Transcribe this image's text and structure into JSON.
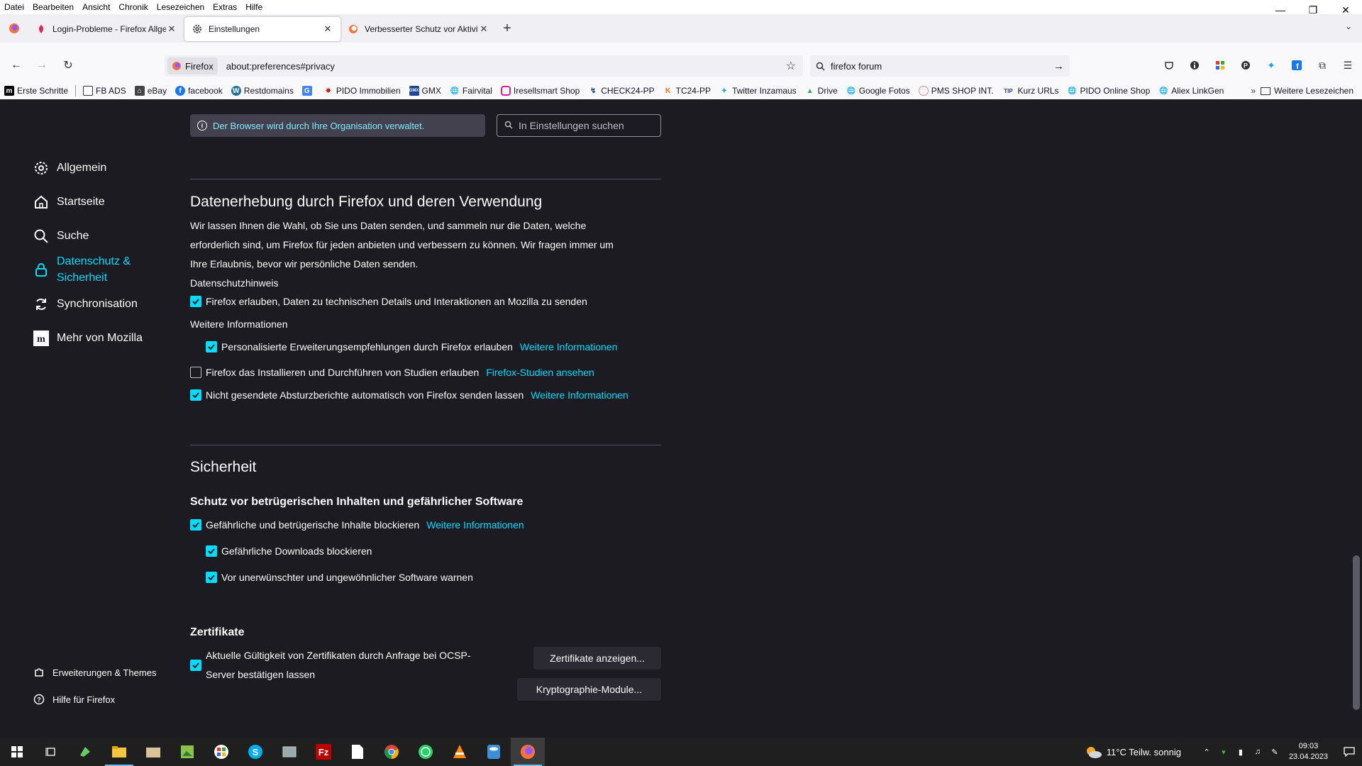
{
  "menubar": [
    "Datei",
    "Bearbeiten",
    "Ansicht",
    "Chronik",
    "Lesezeichen",
    "Extras",
    "Hilfe"
  ],
  "tabs": [
    {
      "title": "Login-Probleme - Firefox Allge"
    },
    {
      "title": "Einstellungen"
    },
    {
      "title": "Verbesserter Schutz vor Aktivitä"
    }
  ],
  "urlbar": {
    "identity": "Firefox",
    "url": "about:preferences#privacy"
  },
  "searchbar": {
    "value": "firefox forum"
  },
  "bookmarks": [
    {
      "label": "Erste Schritte",
      "icon": "mozilla-icon"
    },
    {
      "label": "FB ADS",
      "icon": "note-icon"
    },
    {
      "label": "eBay",
      "icon": "cart-icon"
    },
    {
      "label": "facebook",
      "icon": "facebook-icon"
    },
    {
      "label": "Restdomains",
      "icon": "wordpress-icon"
    },
    {
      "label": "",
      "icon": "translate-icon"
    },
    {
      "label": "PIDO Immobilien",
      "icon": "star-icon"
    },
    {
      "label": "GMX",
      "icon": "gmx-icon"
    },
    {
      "label": "Fairvital",
      "icon": "globe-icon"
    },
    {
      "label": "Iresellsmart Shop",
      "icon": "instagram-icon"
    },
    {
      "label": "CHECK24-PP",
      "icon": "check24-icon"
    },
    {
      "label": "TC24-PP",
      "icon": "k-icon"
    },
    {
      "label": "Twitter Inzamaus",
      "icon": "twitter-icon"
    },
    {
      "label": "Drive",
      "icon": "drive-icon"
    },
    {
      "label": "Google Fotos",
      "icon": "globe-icon"
    },
    {
      "label": "PMS SHOP INT.",
      "icon": "circle-icon"
    },
    {
      "label": "Kurz URLs",
      "icon": "tip-icon"
    },
    {
      "label": "PIDO Online Shop",
      "icon": "globe-icon"
    },
    {
      "label": "Aliex LinkGen",
      "icon": "globe-icon"
    }
  ],
  "other_bookmarks": "Weitere Lesezeichen",
  "policy_notice": "Der Browser wird durch Ihre Organisation verwaltet.",
  "search_placeholder": "In Einstellungen suchen",
  "sidebar": {
    "categories": [
      "Allgemein",
      "Startseite",
      "Suche",
      "Datenschutz &",
      "Sicherheit",
      "Synchronisation",
      "Mehr von Mozilla"
    ],
    "footer": [
      "Erweiterungen & Themes",
      "Hilfe für Firefox"
    ]
  },
  "data_collection": {
    "heading": "Datenerhebung durch Firefox und deren Verwendung",
    "line1": "Wir lassen Ihnen die Wahl, ob Sie uns Daten senden, und sammeln nur die Daten, welche",
    "line2": "erforderlich sind, um Firefox für jeden anbieten und verbessern zu können. Wir fragen immer um",
    "line3": "Ihre Erlaubnis, bevor wir persönliche Daten senden.",
    "privacy_link": "Datenschutzhinweis",
    "telemetry": "Firefox erlauben, Daten zu technischen Details und Interaktionen an Mozilla zu senden",
    "more_info": "Weitere Informationen",
    "addon_recs": "Personalisierte Erweiterungsempfehlungen durch Firefox erlauben",
    "studies": "Firefox das Installieren und Durchführen von Studien erlauben",
    "studies_link": "Firefox-Studien ansehen",
    "crash_reports": "Nicht gesendete Absturzberichte automatisch von Firefox senden lassen"
  },
  "security": {
    "heading": "Sicherheit",
    "subheading": "Schutz vor betrügerischen Inhalten und gefährlicher Software",
    "block_dangerous": "Gefährliche und betrügerische Inhalte blockieren",
    "more_info": "Weitere Informationen",
    "block_downloads": "Gefährliche Downloads blockieren",
    "warn_software": "Vor unerwünschter und ungewöhnlicher Software warnen"
  },
  "certificates": {
    "heading": "Zertifikate",
    "ocsp_line1": "Aktuelle Gültigkeit von Zertifikaten durch Anfrage bei OCSP-",
    "ocsp_line2": "Server bestätigen lassen",
    "view_button": "Zertifikate anzeigen...",
    "crypto_button": "Kryptographie-Module..."
  },
  "taskbar": {
    "weather": "11°C  Teilw. sonnig",
    "time": "09:03",
    "date": "23.04.2023"
  },
  "colors": {
    "accent": "#00ddff",
    "background": "#1c1b22"
  }
}
